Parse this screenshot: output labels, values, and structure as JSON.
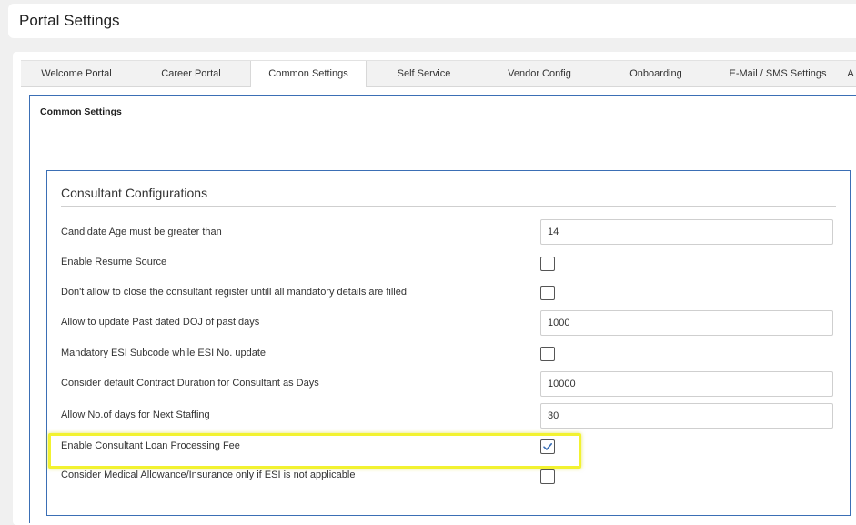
{
  "page": {
    "title": "Portal Settings"
  },
  "tabs": [
    {
      "label": "Welcome Portal"
    },
    {
      "label": "Career Portal"
    },
    {
      "label": "Common Settings",
      "active": true
    },
    {
      "label": "Self Service"
    },
    {
      "label": "Vendor Config"
    },
    {
      "label": "Onboarding"
    },
    {
      "label": "E-Mail / SMS Settings"
    },
    {
      "label": "A"
    }
  ],
  "section": {
    "title": "Common Settings"
  },
  "group": {
    "title": "Consultant Configurations",
    "rows": [
      {
        "label": "Candidate Age must be greater than",
        "type": "text",
        "value": "14"
      },
      {
        "label": "Enable Resume Source",
        "type": "checkbox",
        "checked": false
      },
      {
        "label": "Don't allow to close the consultant register untill all mandatory details are filled",
        "type": "checkbox",
        "checked": false
      },
      {
        "label": "Allow to update Past dated DOJ of past days",
        "type": "text",
        "value": "1000"
      },
      {
        "label": "Mandatory ESI Subcode while ESI No. update",
        "type": "checkbox",
        "checked": false
      },
      {
        "label": "Consider default Contract Duration for Consultant as Days",
        "type": "text",
        "value": "10000"
      },
      {
        "label": "Allow No.of days for Next Staffing",
        "type": "text",
        "value": "30"
      },
      {
        "label": "Enable Consultant Loan Processing Fee",
        "type": "checkbox",
        "checked": true
      },
      {
        "label": "Consider Medical Allowance/Insurance only if ESI is not applicable",
        "type": "checkbox",
        "checked": false
      }
    ]
  },
  "colors": {
    "accent_border": "#3b6fb5",
    "highlight": "#f2f230",
    "check_mark": "#3b6fb5"
  }
}
